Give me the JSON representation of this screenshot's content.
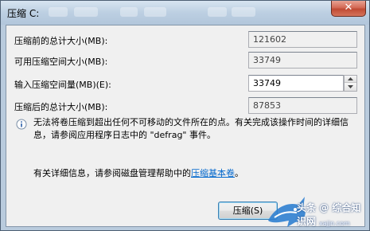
{
  "window": {
    "title": "压缩 C:",
    "close_glyph": "✕"
  },
  "fields": [
    {
      "label": "压缩前的总计大小(MB):",
      "value": "121602"
    },
    {
      "label": "可用压缩空间大小(MB):",
      "value": "33749"
    },
    {
      "label": "输入压缩空间量(MB)(E):",
      "value": "33749"
    },
    {
      "label": "压缩后的总计大小(MB):",
      "value": "87853"
    }
  ],
  "info": {
    "icon": "info-icon",
    "text": "无法将卷压缩到超出任何不可移动的文件所在的点。有关完成该操作时间的详细信息，请参阅应用程序日志中的 \"defrag\" 事件。"
  },
  "detail": {
    "prefix": "有关详细信息，请参阅磁盘管理帮助中的",
    "link": "压缩基本卷",
    "suffix": "。"
  },
  "buttons": {
    "shrink": "压缩(S)"
  },
  "watermark": {
    "text": "头条 @ 综合知识网",
    "url": "xajjn.com"
  },
  "colors": {
    "accent": "#0066cc",
    "close": "#c04a33",
    "frame": "#b9cbdd"
  }
}
